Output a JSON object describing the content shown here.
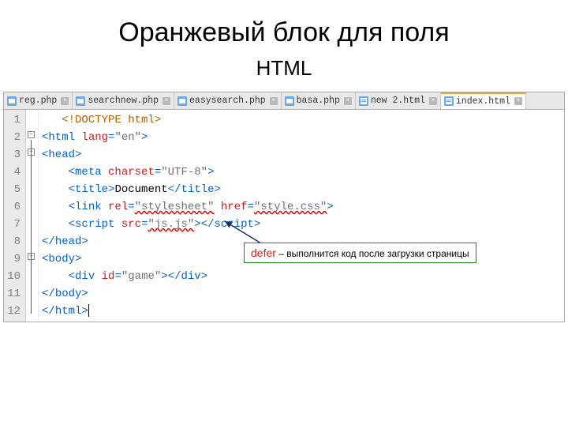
{
  "title": "Оранжевый блок для поля",
  "subtitle": "HTML",
  "tabs": [
    {
      "name": "reg.php",
      "icon": "php",
      "active": false,
      "closable": true
    },
    {
      "name": "searchnew.php",
      "icon": "php",
      "active": false,
      "closable": true
    },
    {
      "name": "easysearch.php",
      "icon": "php",
      "active": false,
      "closable": true
    },
    {
      "name": "basa.php",
      "icon": "php",
      "active": false,
      "closable": true
    },
    {
      "name": "new  2.html",
      "icon": "html",
      "active": false,
      "closable": true
    },
    {
      "name": "index.html",
      "icon": "html",
      "active": true,
      "closable": true
    }
  ],
  "line_numbers": [
    "1",
    "2",
    "3",
    "4",
    "5",
    "6",
    "7",
    "8",
    "9",
    "10",
    "11",
    "12"
  ],
  "code": {
    "l1_doctype": "<!DOCTYPE html>",
    "l2_open": "<",
    "l2_tag": "html",
    "l2_sp": " ",
    "l2_attr": "lang",
    "l2_eq": "=",
    "l2_val": "\"en\"",
    "l2_close": ">",
    "l3_open": "<",
    "l3_tag": "head",
    "l3_close": ">",
    "l4_open": "<",
    "l4_tag": "meta",
    "l4_sp": " ",
    "l4_attr": "charset",
    "l4_eq": "=",
    "l4_val": "\"UTF-8\"",
    "l4_close": ">",
    "l5_open": "<",
    "l5_tag": "title",
    "l5_close": ">",
    "l5_text": "Document",
    "l5_open2": "</",
    "l5_tag2": "title",
    "l5_close2": ">",
    "l6_open": "<",
    "l6_tag": "link",
    "l6_sp": " ",
    "l6_a1": "rel",
    "l6_eq1": "=",
    "l6_v1": "\"stylesheet\"",
    "l6_sp2": " ",
    "l6_a2": "href",
    "l6_eq2": "=",
    "l6_v2": "\"style.css\"",
    "l6_close": ">",
    "l7_open": "<",
    "l7_tag": "script",
    "l7_sp": " ",
    "l7_attr": "src",
    "l7_eq": "=",
    "l7_val": "\"js.js\"",
    "l7_close": ">",
    "l7_open2": "</",
    "l7_tag2": "script",
    "l7_close2": ">",
    "l8_open": "</",
    "l8_tag": "head",
    "l8_close": ">",
    "l9_open": "<",
    "l9_tag": "body",
    "l9_close": ">",
    "l10_open": "<",
    "l10_tag": "div",
    "l10_sp": " ",
    "l10_attr": "id",
    "l10_eq": "=",
    "l10_val": "\"game\"",
    "l10_close": ">",
    "l10_open2": "</",
    "l10_tag2": "div",
    "l10_close2": ">",
    "l11_open": "</",
    "l11_tag": "body",
    "l11_close": ">",
    "l12_open": "</",
    "l12_tag": "html",
    "l12_close": ">"
  },
  "callout": {
    "keyword": "defer",
    "sep": " – ",
    "text": "выполнится код после загрузки страницы"
  }
}
